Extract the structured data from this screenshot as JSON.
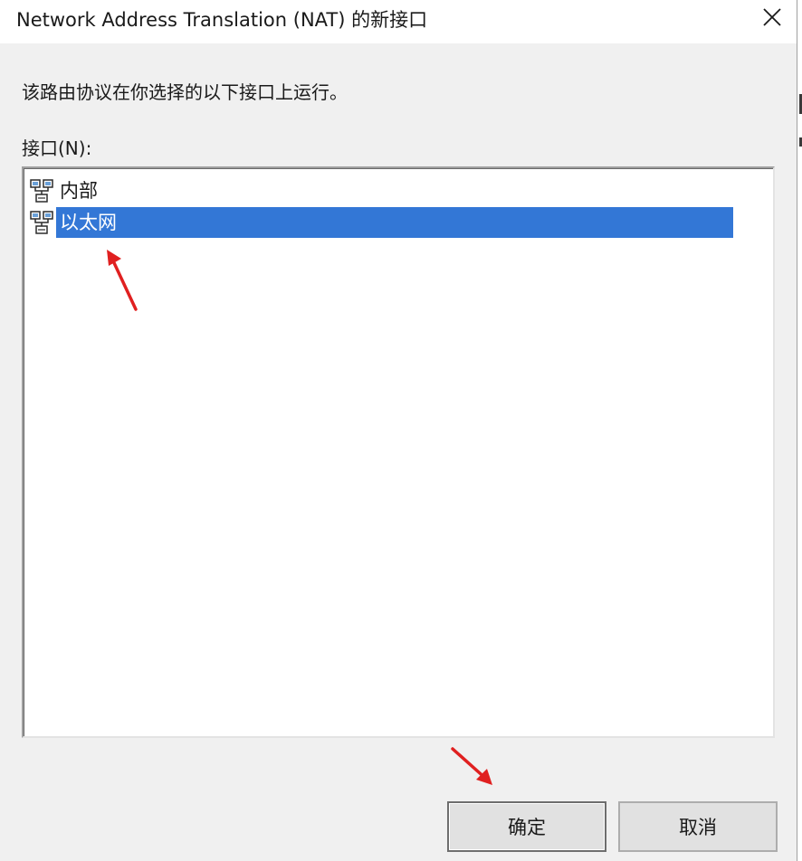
{
  "window": {
    "title": "Network Address Translation (NAT) 的新接口"
  },
  "dialog": {
    "description": "该路由协议在你选择的以下接口上运行。",
    "list_label": "接口(N):",
    "interfaces": [
      {
        "label": "内部",
        "icon": "network-interface-icon",
        "selected": false
      },
      {
        "label": "以太网",
        "icon": "network-interface-icon",
        "selected": true
      }
    ],
    "ok_label": "确定",
    "cancel_label": "取消"
  },
  "annotations": {
    "arrow_color": "#e02020"
  },
  "colors": {
    "selection": "#3377d6",
    "dialog_bg": "#f0f0f0"
  }
}
